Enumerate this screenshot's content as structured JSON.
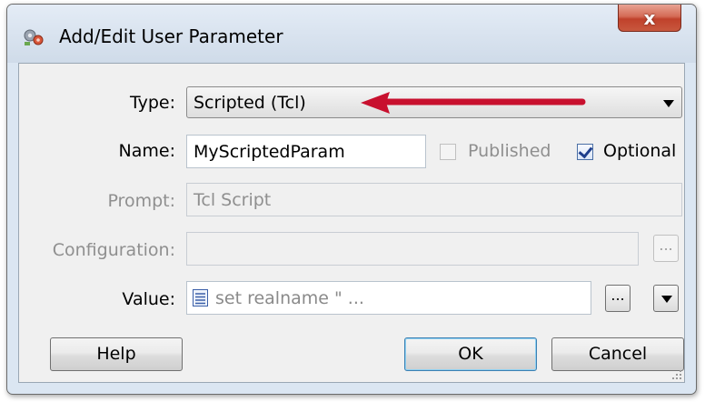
{
  "dialog": {
    "title": "Add/Edit User Parameter",
    "close_glyph": "x"
  },
  "form": {
    "type_label": "Type:",
    "type_value": "Scripted (Tcl)",
    "name_label": "Name:",
    "name_value": "MyScriptedParam",
    "published_label": "Published",
    "published_checked": false,
    "optional_label": "Optional",
    "optional_checked": true,
    "prompt_label": "Prompt:",
    "prompt_value": "Tcl Script",
    "configuration_label": "Configuration:",
    "configuration_value": "",
    "configuration_browse": "...",
    "value_label": "Value:",
    "value_text": "set realname \" ...",
    "value_browse": "..."
  },
  "buttons": {
    "help": "Help",
    "ok": "OK",
    "cancel": "Cancel"
  },
  "colors": {
    "annotation_arrow": "#c8102e",
    "window_frame": "#dbe6f2",
    "close_button": "#c8583e"
  },
  "icons": [
    "app-icon",
    "close-icon",
    "script-icon",
    "dropdown-arrow-icon",
    "checkmark-icon",
    "resize-grip-icon",
    "annotation-arrow-icon"
  ]
}
